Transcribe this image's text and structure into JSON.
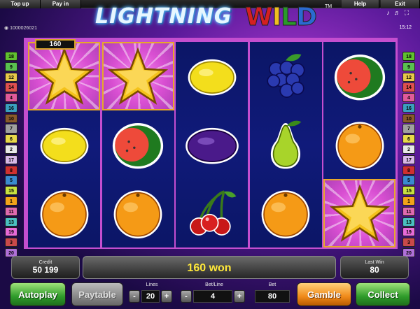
{
  "menu": {
    "topup": "Top up",
    "payin": "Pay in",
    "help": "Help",
    "exit": "Exit"
  },
  "logo": {
    "part1": "LIGHTNING",
    "part2_letters": [
      "W",
      "I",
      "L",
      "D"
    ],
    "tm": "TM"
  },
  "account": {
    "id": "1000026021"
  },
  "clock": "15:12",
  "header_icons": [
    "music-note-icon",
    "sound-icon",
    "fullscreen-icon"
  ],
  "lines_left": [
    "18",
    "9",
    "12",
    "14",
    "4",
    "16",
    "10",
    "7",
    "6",
    "2",
    "17",
    "8",
    "5",
    "15",
    "1",
    "11",
    "13",
    "19",
    "3",
    "20"
  ],
  "lines_right": [
    "18",
    "9",
    "12",
    "14",
    "4",
    "16",
    "10",
    "7",
    "6",
    "2",
    "17",
    "8",
    "5",
    "15",
    "1",
    "11",
    "13",
    "19",
    "3",
    "20"
  ],
  "line_colors": {
    "1": "#f2a31a",
    "2": "#e8e8e8",
    "3": "#c94a4a",
    "4": "#e05a9a",
    "5": "#3a8ad0",
    "6": "#e8d84a",
    "7": "#a0a0a0",
    "8": "#d03030",
    "9": "#5ac050",
    "10": "#8b5a2b",
    "11": "#e06ab0",
    "12": "#e8c84a",
    "13": "#4ac0c0",
    "14": "#e05050",
    "15": "#c8e040",
    "16": "#3aa0c0",
    "17": "#d8b8e8",
    "18": "#60c030",
    "19": "#e86ad8",
    "20": "#b070d8"
  },
  "reels": [
    [
      "star",
      "lemon",
      "orange"
    ],
    [
      "star",
      "watermelon",
      "orange"
    ],
    [
      "lemon",
      "plum",
      "cherries"
    ],
    [
      "grapes",
      "pear",
      "orange"
    ],
    [
      "watermelon",
      "orange",
      "star"
    ]
  ],
  "win_cells": [
    [
      0,
      0
    ],
    [
      1,
      0
    ],
    [
      4,
      2
    ]
  ],
  "win_badge": "160",
  "credit": {
    "label": "Credit",
    "value": "50 199"
  },
  "message": "160  won",
  "last_win": {
    "label": "Last Win",
    "value": "80"
  },
  "buttons": {
    "autoplay": "Autoplay",
    "paytable": "Paytable",
    "gamble": "Gamble",
    "collect": "Collect"
  },
  "lines": {
    "label": "Lines",
    "value": "20"
  },
  "bet_line": {
    "label": "Bet/Line",
    "value": "4"
  },
  "bet": {
    "label": "Bet",
    "value": "80"
  },
  "stepper_symbols": {
    "minus": "-",
    "plus": "+"
  }
}
